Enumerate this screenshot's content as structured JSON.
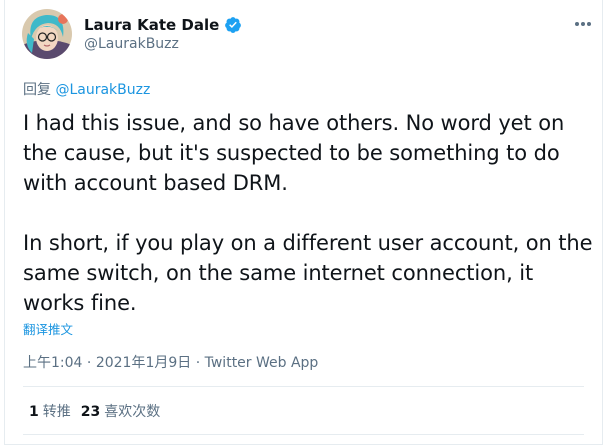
{
  "author": {
    "name": "Laura Kate Dale",
    "handle": "@LaurakBuzz",
    "verified": true
  },
  "reply": {
    "prefix": "回复 ",
    "mention": "@LaurakBuzz"
  },
  "tweet": {
    "paragraph1": "I had this issue, and so have others. No word yet on the cause, but it's suspected to be something to do with account based DRM.",
    "paragraph2": "In short, if you play on a different user account, on the same switch, on the same internet connection, it works fine."
  },
  "translate_label": "翻译推文",
  "meta": {
    "time": "上午1:04",
    "separator": " · ",
    "date": "2021年1月9日",
    "source": "Twitter Web App"
  },
  "stats": {
    "retweets": "1",
    "retweets_label": "转推",
    "likes": "23",
    "likes_label": "喜欢次数"
  },
  "colors": {
    "accent": "#1b95e0",
    "secondary_text": "#5b7083",
    "primary_text": "#0f1419",
    "divider": "#e6ecf0"
  }
}
